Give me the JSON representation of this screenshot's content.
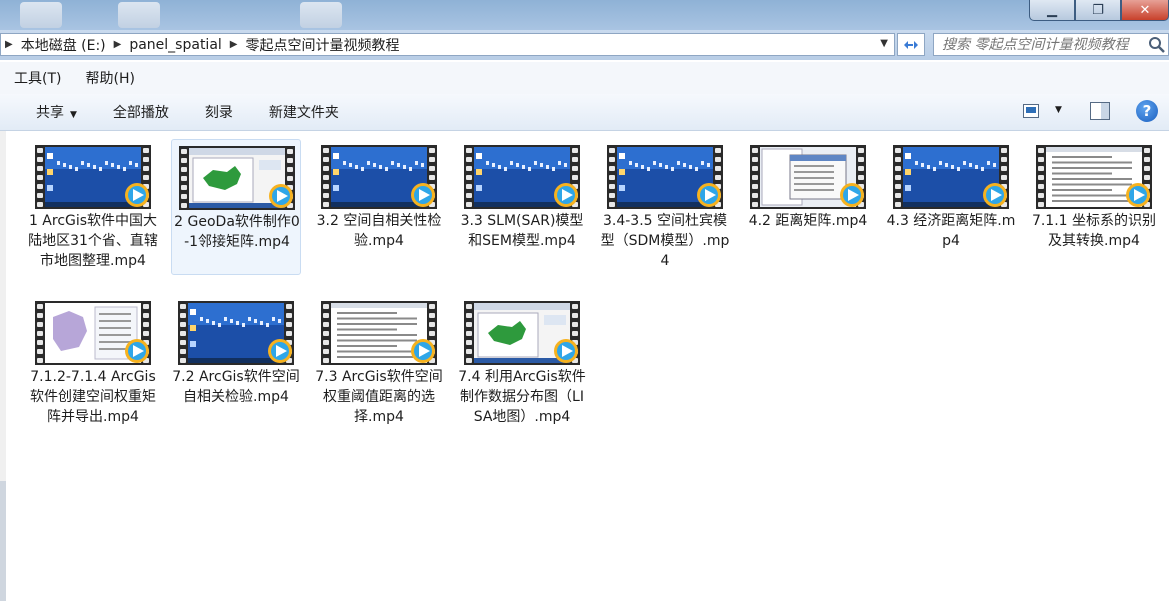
{
  "address": {
    "crumbs": [
      "本地磁盘 (E:)",
      "panel_spatial",
      "零起点空间计量视频教程"
    ],
    "search_placeholder": "搜索 零起点空间计量视频教程"
  },
  "menu": [
    "工具(T)",
    "帮助(H)"
  ],
  "commands": {
    "share": "共享",
    "play_all": "全部播放",
    "burn": "刻录",
    "new_folder": "新建文件夹"
  },
  "files": [
    {
      "name": "1 ArcGis软件中国大陆地区31个省、直辖市地图整理.mp4",
      "thumb": "desktop"
    },
    {
      "name": "2 GeoDa软件制作0-1邻接矩阵.mp4",
      "thumb": "map-app",
      "selected": true
    },
    {
      "name": "3.2 空间自相关性检验.mp4",
      "thumb": "desktop"
    },
    {
      "name": "3.3 SLM(SAR)模型和SEM模型.mp4",
      "thumb": "desktop"
    },
    {
      "name": "3.4-3.5 空间杜宾模型（SDM模型）.mp4",
      "thumb": "desktop"
    },
    {
      "name": "4.2 距离矩阵.mp4",
      "thumb": "dialog"
    },
    {
      "name": "4.3 经济距离矩阵.mp4",
      "thumb": "desktop"
    },
    {
      "name": "7.1.1 坐标系的识别及其转换.mp4",
      "thumb": "document"
    },
    {
      "name": "7.1.2-7.1.4 ArcGis软件创建空间权重矩阵并导出.mp4",
      "thumb": "purple-map"
    },
    {
      "name": "7.2 ArcGis软件空间自相关检验.mp4",
      "thumb": "desktop"
    },
    {
      "name": "7.3 ArcGis软件空间权重阈值距离的选择.mp4",
      "thumb": "document"
    },
    {
      "name": "7.4 利用ArcGis软件制作数据分布图（LISA地图）.mp4",
      "thumb": "map-app"
    }
  ]
}
